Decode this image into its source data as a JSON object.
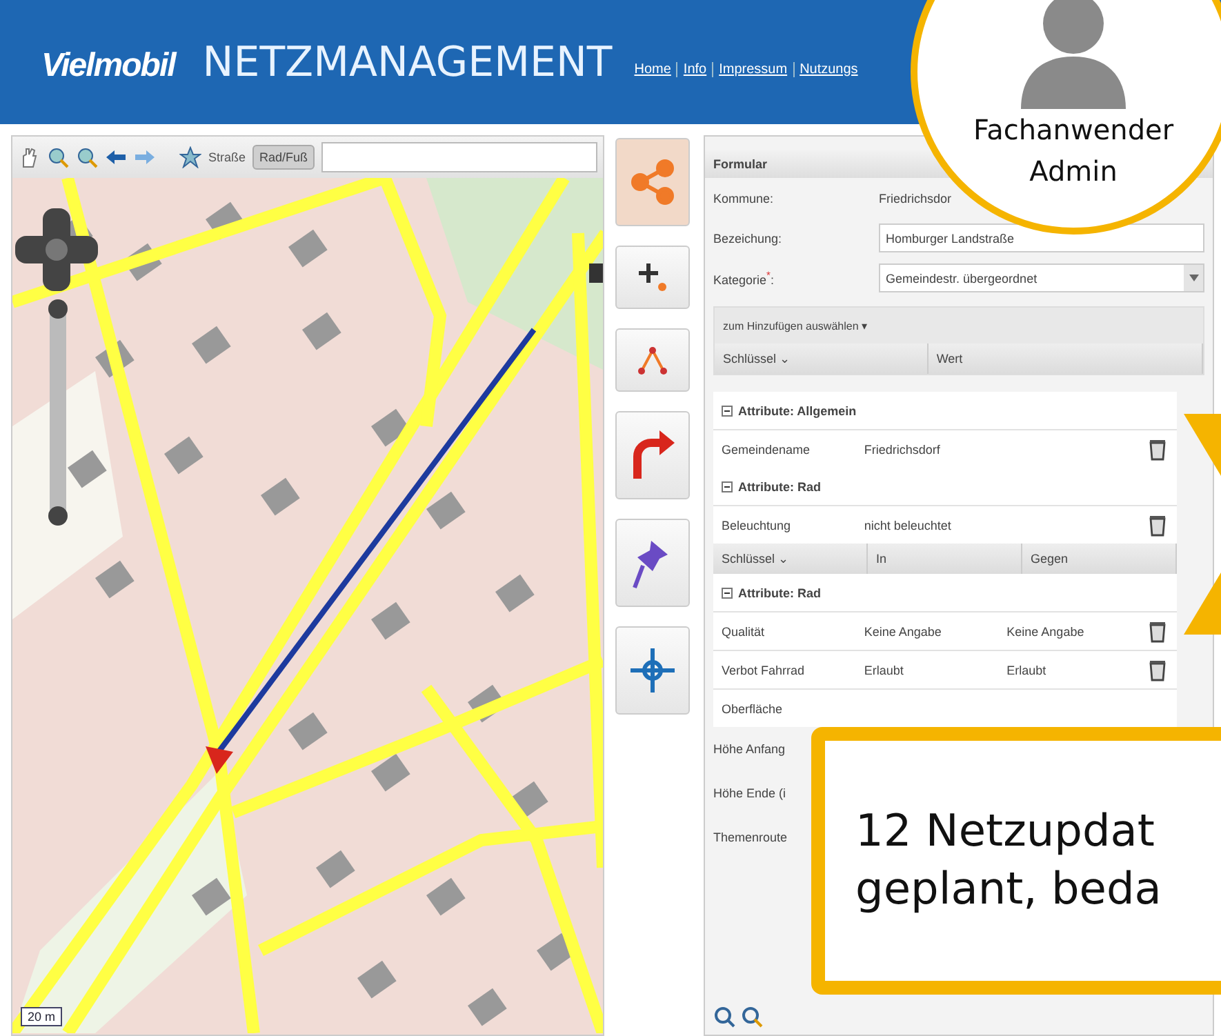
{
  "header": {
    "logo": "Vielmobil",
    "title": "NETZMANAGEMENT",
    "links": [
      "Home",
      "Info",
      "Impressum",
      "Nutzungs"
    ]
  },
  "user_badge": {
    "lines": [
      "Fachanwender",
      "Admin"
    ]
  },
  "map_toolbar": {
    "mode_label": "Straße",
    "modes": [
      {
        "label": "Rad/Fuß",
        "selected": true
      }
    ]
  },
  "map": {
    "scale": "20 m"
  },
  "tools": [
    {
      "kind": "share",
      "selected": true
    },
    {
      "kind": "add",
      "selected": false
    },
    {
      "kind": "nodes",
      "selected": false
    },
    {
      "kind": "turn",
      "selected": false
    },
    {
      "kind": "pin",
      "selected": false
    },
    {
      "kind": "crosshair",
      "selected": false
    }
  ],
  "form": {
    "title": "Formular",
    "fields": [
      {
        "kind": "text",
        "label": "Kommune:",
        "value": "Friedrichsdor"
      },
      {
        "kind": "input",
        "label": "Bezeichung:",
        "value": "Homburger Landstraße"
      },
      {
        "kind": "select",
        "label": "Kategorie$^{*}$:",
        "value": "Gemeindestr. übergeordnet"
      }
    ],
    "add_menu": "zum Hinzufügen auswählen ▾",
    "grid_header": [
      "Schlüssel ⌄",
      "Wert"
    ],
    "sections": [
      {
        "title": "Attribute: Allgemein",
        "expanded": true,
        "rows": [
          [
            "Gemeindename",
            "Friedrichsdorf"
          ]
        ]
      },
      {
        "title": "Attribute: Rad",
        "expanded": true,
        "rows": [
          [
            "Beleuchtung",
            "nicht beleuchtet"
          ]
        ],
        "sub_headers": [
          "Schlüssel ⌄",
          "In",
          "Gegen"
        ]
      },
      {
        "title": "Attribute: Rad",
        "expanded": true,
        "rows": [
          [
            "Qualität",
            "Keine Angabe",
            "Keine Angabe"
          ],
          [
            "Verbot Fahrrad",
            "Erlaubt",
            "Erlaubt"
          ],
          [
            "Oberfläche"
          ]
        ]
      }
    ],
    "extra_labels": [
      "Höhe Anfang",
      "Höhe Ende (i",
      "Themenroute"
    ]
  },
  "callout": {
    "lines": [
      "12 Netzupdat",
      "geplant, beda"
    ]
  }
}
